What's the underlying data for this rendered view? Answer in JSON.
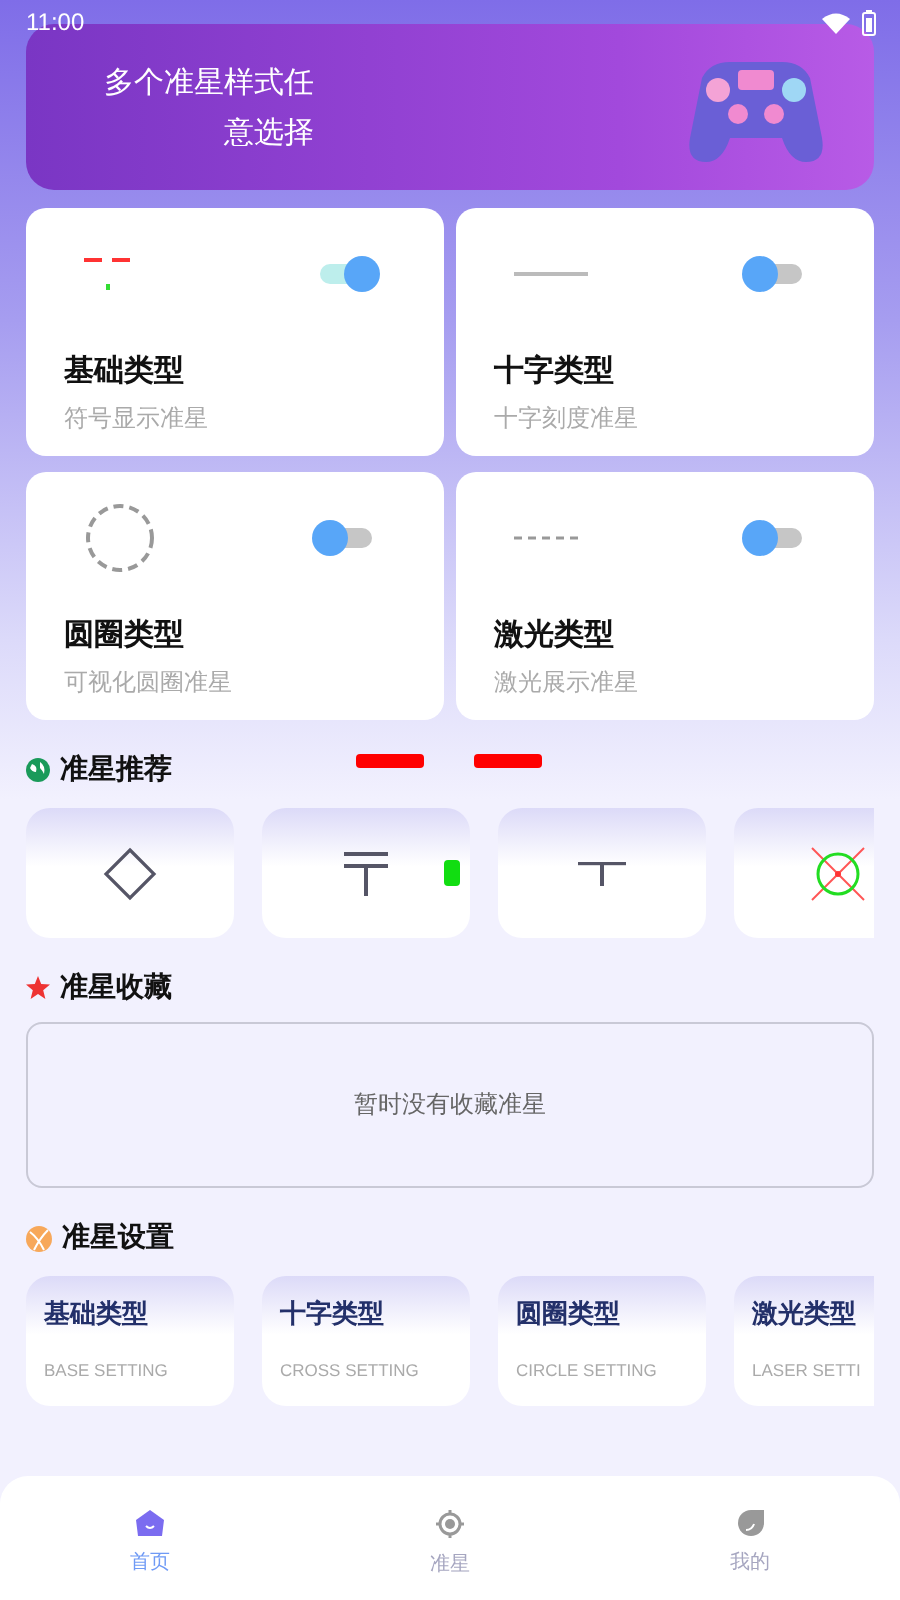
{
  "status_bar": {
    "time": "11:00"
  },
  "banner": {
    "title": "多个准星样式任意选择"
  },
  "types": [
    {
      "kind": "basic",
      "title": "基础类型",
      "subtitle": "符号显示准星",
      "on": true
    },
    {
      "kind": "cross",
      "title": "十字类型",
      "subtitle": "十字刻度准星",
      "on": false
    },
    {
      "kind": "circle",
      "title": "圆圈类型",
      "subtitle": "可视化圆圈准星",
      "on": false
    },
    {
      "kind": "laser",
      "title": "激光类型",
      "subtitle": "激光展示准星",
      "on": false
    }
  ],
  "recommend": {
    "title": "准星推荐",
    "items": [
      {
        "kind": "diamond"
      },
      {
        "kind": "double-t"
      },
      {
        "kind": "t"
      },
      {
        "kind": "circle-x"
      }
    ]
  },
  "favorites": {
    "title": "准星收藏",
    "empty_text": "暂时没有收藏准星"
  },
  "settings": {
    "title": "准星设置",
    "items": [
      {
        "title": "基础类型",
        "subtitle": "BASE SETTING"
      },
      {
        "title": "十字类型",
        "subtitle": "CROSS SETTING"
      },
      {
        "title": "圆圈类型",
        "subtitle": "CIRCLE SETTING"
      },
      {
        "title": "激光类型",
        "subtitle": "LASER SETTI"
      }
    ]
  },
  "nav": [
    {
      "label": "首页",
      "kind": "home",
      "selected": true
    },
    {
      "label": "准星",
      "kind": "crosshair",
      "selected": false
    },
    {
      "label": "我的",
      "kind": "profile",
      "selected": false
    }
  ]
}
